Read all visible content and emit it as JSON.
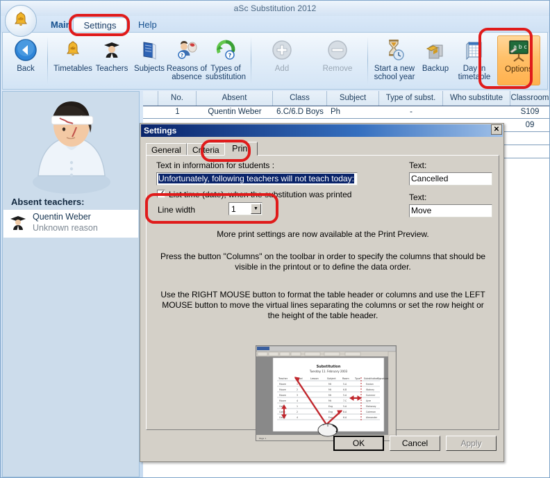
{
  "window": {
    "title": "aSc Substitution 2012"
  },
  "ribbon": {
    "tabs": [
      {
        "label": "Main",
        "active": false
      },
      {
        "label": "Settings",
        "active": true
      },
      {
        "label": "Help",
        "active": false
      }
    ],
    "buttons": [
      {
        "label": "Back",
        "icon": "back-arrow-icon",
        "disabled": false
      },
      {
        "label": "Timetables",
        "icon": "bell-icon",
        "disabled": false
      },
      {
        "label": "Teachers",
        "icon": "teacher-icon",
        "disabled": false
      },
      {
        "label": "Subjects",
        "icon": "book-icon",
        "disabled": false
      },
      {
        "label": "Reasons of absence",
        "icon": "absence-icon",
        "disabled": false
      },
      {
        "label": "Types of substitution",
        "icon": "recycle-icon",
        "disabled": false
      },
      {
        "label": "Add",
        "icon": "plus-icon",
        "disabled": true
      },
      {
        "label": "Remove",
        "icon": "minus-icon",
        "disabled": true
      },
      {
        "label": "Start a new school year",
        "icon": "hourglass-icon",
        "disabled": false
      },
      {
        "label": "Backup",
        "icon": "backup-icon",
        "disabled": false
      },
      {
        "label": "Day in timetable",
        "icon": "calendar-icon",
        "disabled": false
      },
      {
        "label": "Options",
        "icon": "blackboard-abc-icon",
        "disabled": false
      }
    ]
  },
  "sidebar": {
    "avatar_name": "injured-teacher-avatar",
    "absent_label": "Absent teachers:",
    "absent_teachers": [
      {
        "name": "Quentin Weber",
        "reason": "Unknown reason"
      }
    ]
  },
  "table": {
    "headers": [
      "",
      "No.",
      "Absent",
      "Class",
      "Subject",
      "Type of subst.",
      "Who substitute",
      "Classroom"
    ],
    "rows": [
      {
        "no": "1",
        "absent": "Quentin Weber",
        "class": "6.C/6.D Boys",
        "subject": "Ph",
        "type": "-",
        "who": "",
        "classroom": "S109"
      },
      {
        "no": "",
        "absent": "",
        "class": "",
        "subject": "",
        "type": "",
        "who": "",
        "classroom": "09"
      }
    ]
  },
  "dialog": {
    "title": "Settings",
    "close_label": "✕",
    "tabs": [
      {
        "label": "General",
        "active": false
      },
      {
        "label": "Criteria",
        "active": false
      },
      {
        "label": "Print",
        "active": true
      }
    ],
    "students_text_label": "Text in information for students :",
    "students_text_value": "Unfortunately, following teachers will not teach today:",
    "list_time_checkbox_label": "List time (date), when the substitution was printed",
    "list_time_checked": true,
    "line_width_label": "Line width",
    "line_width_value": "1",
    "right_fields": [
      {
        "label": "Text:",
        "value": "Cancelled"
      },
      {
        "label": "Text:",
        "value": "Move"
      }
    ],
    "info_paragraphs": [
      "More print settings are now available at the Print Preview.",
      "Press the button \"Columns\" on the toolbar in order to specify the columns that should be visible in the printout or to define the data order.",
      "Use the RIGHT MOUSE button to format the table header or columns and use the LEFT MOUSE button to move the virtual lines separating the columns or set the row height or the height of the table header."
    ],
    "preview": {
      "name": "print-preview-illustration",
      "doc_title": "Substitution",
      "doc_subtitle": "Tuesday 11. February 2003",
      "columns": [
        "Teacher",
        "Period",
        "Lesson",
        "Subject",
        "Room",
        "Type",
        "Substitution",
        "Signature"
      ]
    },
    "buttons": [
      {
        "label": "OK",
        "state": "default"
      },
      {
        "label": "Cancel",
        "state": "normal"
      },
      {
        "label": "Apply",
        "state": "disabled"
      }
    ]
  },
  "annotations": {
    "color": "#e01b1b",
    "rings": [
      "settings-tab-ring",
      "options-button-ring",
      "print-tab-ring",
      "line-width-ring"
    ]
  }
}
